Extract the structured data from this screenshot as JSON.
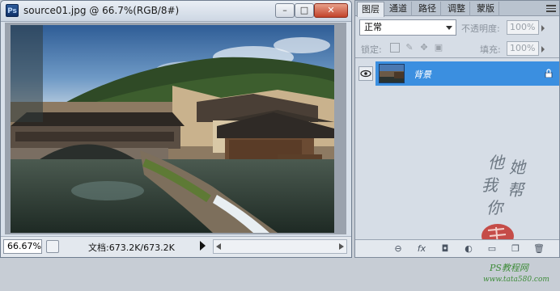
{
  "document": {
    "app_badge": "Ps",
    "title": "source01.jpg @ 66.7%(RGB/8#)",
    "min_label": "–",
    "max_label": "□",
    "close_label": "✕",
    "zoom": "66.67%",
    "doc_info": "文档:673.2K/673.2K"
  },
  "layers_panel": {
    "tabs": [
      "图层",
      "通道",
      "路径",
      "调整",
      "蒙版"
    ],
    "active_tab": "图层",
    "blend_mode": "正常",
    "opacity_label": "不透明度:",
    "opacity_value": "100%",
    "lock_label": "锁定:",
    "fill_label": "填充:",
    "fill_value": "100%",
    "layer": {
      "name": "背景",
      "visible": true,
      "locked": true
    },
    "watermark": {
      "chars": [
        "他",
        "她",
        "我",
        "帮",
        "你"
      ],
      "site_label": "PS教程网",
      "site_url": "www.tata580.com"
    }
  },
  "colors": {
    "accent": "#3b8fe0",
    "close_button": "#c2432b",
    "watermark_text": "#6d7883",
    "watermark_site": "#3f8c3a"
  },
  "icons": [
    "ps-logo-icon",
    "minimize-icon",
    "maximize-icon",
    "close-icon",
    "status-menu-icon",
    "play-arrow-icon",
    "eye-icon",
    "lock-icon",
    "panel-menu-icon",
    "link-icon",
    "fx-icon",
    "mask-icon",
    "adjustment-icon",
    "group-folder-icon",
    "new-layer-icon",
    "trash-icon"
  ]
}
